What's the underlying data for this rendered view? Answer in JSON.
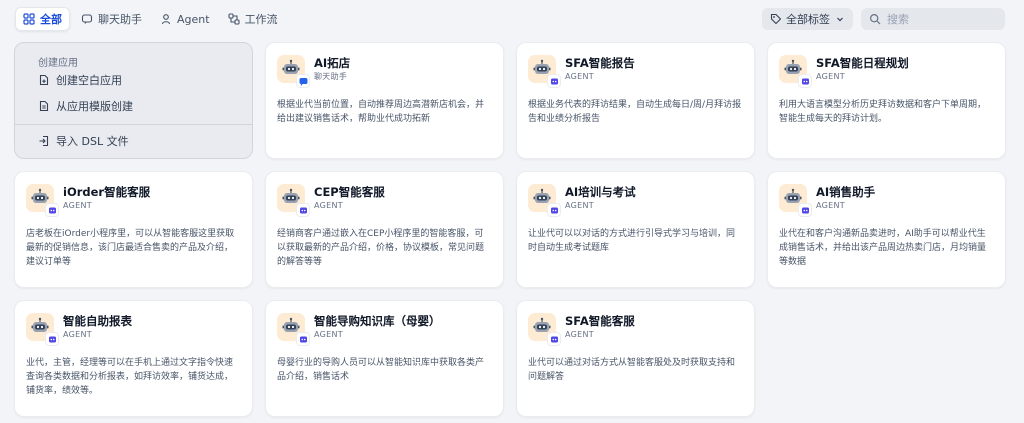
{
  "tabs": [
    {
      "label": "全部",
      "icon": "grid-icon",
      "active": true
    },
    {
      "label": "聊天助手",
      "icon": "chat-icon",
      "active": false
    },
    {
      "label": "Agent",
      "icon": "agent-icon",
      "active": false
    },
    {
      "label": "工作流",
      "icon": "workflow-icon",
      "active": false
    }
  ],
  "tag_filter": {
    "label": "全部标签",
    "icon": "tag-icon"
  },
  "search": {
    "placeholder": "搜索",
    "value": ""
  },
  "create": {
    "title": "创建应用",
    "options": [
      {
        "label": "创建空白应用",
        "icon": "new-file-icon"
      },
      {
        "label": "从应用模版创建",
        "icon": "template-icon"
      },
      {
        "label": "导入 DSL 文件",
        "icon": "import-icon"
      }
    ]
  },
  "apps": [
    {
      "name": "AI拓店",
      "type": "聊天助手",
      "badge": "chat-badge",
      "description": "根据业代当前位置，自动推荐周边高潜新店机会，并给出建议销售话术，帮助业代成功拓新"
    },
    {
      "name": "SFA智能报告",
      "type": "AGENT",
      "badge": "agent-badge",
      "description": "根据业务代表的拜访结果，自动生成每日/周/月拜访报告和业绩分析报告"
    },
    {
      "name": "SFA智能日程规划",
      "type": "AGENT",
      "badge": "agent-badge",
      "description": "利用大语言模型分析历史拜访数据和客户下单周期，智能生成每天的拜访计划。"
    },
    {
      "name": "iOrder智能客服",
      "type": "AGENT",
      "badge": "agent-badge",
      "description": "店老板在iOrder小程序里，可以从智能客服这里获取最新的促销信息，该门店最适合售卖的产品及介绍，建议订单等"
    },
    {
      "name": "CEP智能客服",
      "type": "AGENT",
      "badge": "agent-badge",
      "description": "经销商客户通过嵌入在CEP小程序里的智能客服，可以获取最新的产品介绍，价格，协议模板，常见问题的解答等等"
    },
    {
      "name": "AI培训与考试",
      "type": "AGENT",
      "badge": "agent-badge",
      "description": "让业代可以以对话的方式进行引导式学习与培训，同时自动生成考试题库"
    },
    {
      "name": "AI销售助手",
      "type": "AGENT",
      "badge": "agent-badge",
      "description": "业代在和客户沟通新品卖进时，AI助手可以帮业代生成销售话术，并给出该产品周边热卖门店，月均销量等数据"
    },
    {
      "name": "智能自助报表",
      "type": "AGENT",
      "badge": "agent-badge",
      "description": "业代，主管，经理等可以在手机上通过文字指令快速查询各类数据和分析报表，如拜访效率，铺货达成，铺货率，绩效等。"
    },
    {
      "name": "智能导购知识库（母婴）",
      "type": "AGENT",
      "badge": "agent-badge",
      "description": "母婴行业的导购人员可以从智能知识库中获取各类产品介绍，销售话术"
    },
    {
      "name": "SFA智能客服",
      "type": "AGENT",
      "badge": "agent-badge",
      "description": "业代可以通过对话方式从智能客服处及时获取支持和问题解答"
    }
  ],
  "colors": {
    "accent": "#1d4ed8",
    "avatar_bg": "#fdebd3",
    "chat_badge": "#2563eb",
    "agent_badge": "#4f46e5"
  }
}
